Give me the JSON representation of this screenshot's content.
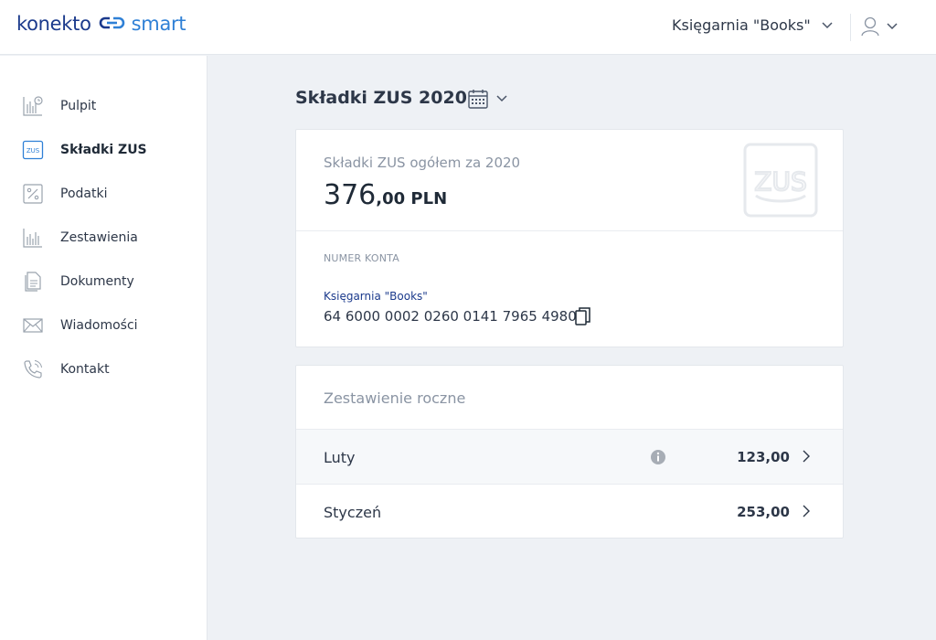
{
  "header": {
    "logo_brand": "konekto",
    "logo_product": "smart",
    "company_name": "Księgarnia \"Books\""
  },
  "sidebar": {
    "items": [
      {
        "label": "Pulpit",
        "icon": "dashboard-chart-icon"
      },
      {
        "label": "Składki ZUS",
        "icon": "zus-icon",
        "active": true
      },
      {
        "label": "Podatki",
        "icon": "percent-icon"
      },
      {
        "label": "Zestawienia",
        "icon": "bar-chart-icon"
      },
      {
        "label": "Dokumenty",
        "icon": "documents-icon"
      },
      {
        "label": "Wiadomości",
        "icon": "envelope-icon"
      },
      {
        "label": "Kontakt",
        "icon": "phone-icon"
      }
    ]
  },
  "main": {
    "title": "Składki ZUS 2020",
    "summary": {
      "label": "Składki ZUS ogółem za 2020",
      "amount_int": "376",
      "amount_dec": ",00 PLN",
      "watermark_text": "ZUS"
    },
    "account": {
      "caption": "NUMER KONTA",
      "owner": "Księgarnia \"Books\"",
      "number": "64 6000 0002 0260 0141 7965 4980"
    },
    "yearly": {
      "title": "Zestawienie roczne",
      "rows": [
        {
          "month": "Luty",
          "value": "123,00",
          "info": true
        },
        {
          "month": "Styczeń",
          "value": "253,00",
          "info": false
        }
      ]
    }
  },
  "colors": {
    "brand_dark": "#1b3a8c",
    "brand_light": "#2f80d6",
    "background": "#eef1f5"
  }
}
